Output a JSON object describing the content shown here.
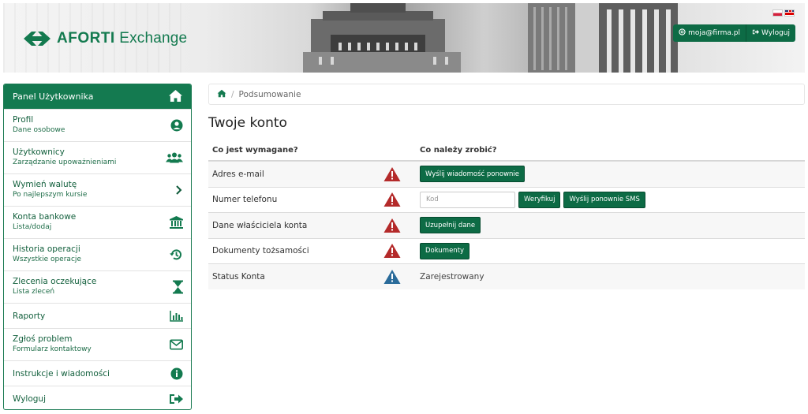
{
  "header": {
    "logo_bold": "AFORTI",
    "logo_rest": " Exchange",
    "user_email": "moja@firma.pl",
    "logout_label": "Wyloguj",
    "brand_color": "#137a4f"
  },
  "sidebar": {
    "title": "Panel Użytkownika",
    "items": [
      {
        "title": "Profil",
        "subtitle": "Dane osobowe",
        "icon": "user-circle-icon"
      },
      {
        "title": "Użytkownicy",
        "subtitle": "Zarządzanie upoważnieniami",
        "icon": "users-icon"
      },
      {
        "title": "Wymień walutę",
        "subtitle": "Po najlepszym kursie",
        "icon": "chevron-right-icon"
      },
      {
        "title": "Konta bankowe",
        "subtitle": "Lista/dodaj",
        "icon": "bank-icon"
      },
      {
        "title": "Historia operacji",
        "subtitle": "Wszystkie operacje",
        "icon": "history-icon"
      },
      {
        "title": "Zlecenia oczekujące",
        "subtitle": "Lista zleceń",
        "icon": "hourglass-icon"
      },
      {
        "title": "Raporty",
        "subtitle": "",
        "icon": "bar-chart-icon"
      },
      {
        "title": "Zgłoś problem",
        "subtitle": "Formularz kontaktowy",
        "icon": "envelope-icon"
      },
      {
        "title": "Instrukcje i wiadomości",
        "subtitle": "",
        "icon": "info-icon"
      },
      {
        "title": "Wyloguj",
        "subtitle": "",
        "icon": "sign-out-icon"
      }
    ]
  },
  "breadcrumb": {
    "current": "Podsumowanie"
  },
  "main": {
    "title": "Twoje konto",
    "col1": "Co jest wymagane?",
    "col2": "Co należy zrobić?",
    "rows": [
      {
        "label": "Adres e-mail",
        "button": "Wyślij wiadomość ponownie"
      },
      {
        "label": "Numer telefonu",
        "code_placeholder": "Kod",
        "verify": "Weryfikuj",
        "resend_sms": "Wyślij ponownie SMS"
      },
      {
        "label": "Dane właściciela konta",
        "button": "Uzupełnij dane"
      },
      {
        "label": "Dokumenty tożsamości",
        "button": "Dokumenty"
      },
      {
        "label": "Status Konta",
        "status": "Zarejestrowany"
      }
    ]
  }
}
